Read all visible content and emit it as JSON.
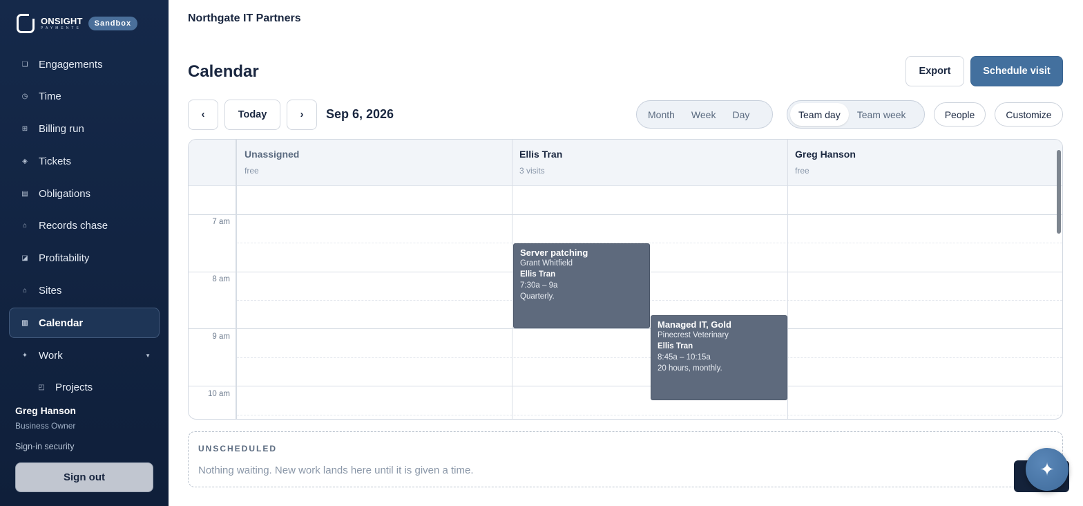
{
  "brand": {
    "name": "ONSIGHT",
    "sub": "PAYMENTS",
    "env_badge": "Sandbox"
  },
  "nav": {
    "items": [
      {
        "label": "Engagements",
        "icon": "square-icon",
        "glyph": "❏"
      },
      {
        "label": "Time",
        "icon": "clock-icon",
        "glyph": "◷"
      },
      {
        "label": "Billing run",
        "icon": "grid-icon",
        "glyph": "⊞"
      },
      {
        "label": "Tickets",
        "icon": "diamond-icon",
        "glyph": "◈"
      },
      {
        "label": "Obligations",
        "icon": "list-icon",
        "glyph": "▤"
      },
      {
        "label": "Records chase",
        "icon": "house-icon",
        "glyph": "⌂"
      },
      {
        "label": "Profitability",
        "icon": "chart-icon",
        "glyph": "◪"
      },
      {
        "label": "Sites",
        "icon": "home-icon",
        "glyph": "⌂"
      },
      {
        "label": "Calendar",
        "icon": "calendar-icon",
        "glyph": "▥"
      },
      {
        "label": "Work",
        "icon": "sparkle-icon",
        "glyph": "✦"
      },
      {
        "label": "Projects",
        "icon": "projects-icon",
        "glyph": "◰"
      }
    ],
    "active": "Calendar"
  },
  "user": {
    "name": "Greg Hanson",
    "role": "Business Owner",
    "security_link": "Sign-in security",
    "sign_out": "Sign out"
  },
  "header": {
    "org": "Northgate IT Partners",
    "title": "Calendar",
    "export": "Export",
    "schedule": "Schedule visit"
  },
  "toolbar": {
    "prev": "‹",
    "today": "Today",
    "next": "›",
    "date": "Sep 6, 2026",
    "range_options": [
      "Month",
      "Week",
      "Day"
    ],
    "team_options": [
      "Team day",
      "Team week"
    ],
    "team_selected": "Team day",
    "people": "People",
    "customize": "Customize"
  },
  "calendar": {
    "columns": [
      {
        "name": "Unassigned",
        "sub": "free"
      },
      {
        "name": "Ellis Tran",
        "sub": "3 visits"
      },
      {
        "name": "Greg Hanson",
        "sub": "free"
      }
    ],
    "hours": [
      "7 am",
      "8 am",
      "9 am",
      "10 am"
    ],
    "events": [
      {
        "title": "Server patching",
        "client": "Grant Whitfield",
        "assignee": "Ellis Tran",
        "time": "7:30a – 9a",
        "note": "Quarterly."
      },
      {
        "title": "Managed IT, Gold",
        "client": "Pinecrest Veterinary",
        "assignee": "Ellis Tran",
        "time": "8:45a – 10:15a",
        "note": "20 hours, monthly."
      }
    ]
  },
  "unscheduled": {
    "title": "UNSCHEDULED",
    "message": "Nothing waiting. New work lands here until it is given a time."
  },
  "assistant": {
    "icon": "sparkle-icon",
    "glyph": "✦"
  }
}
